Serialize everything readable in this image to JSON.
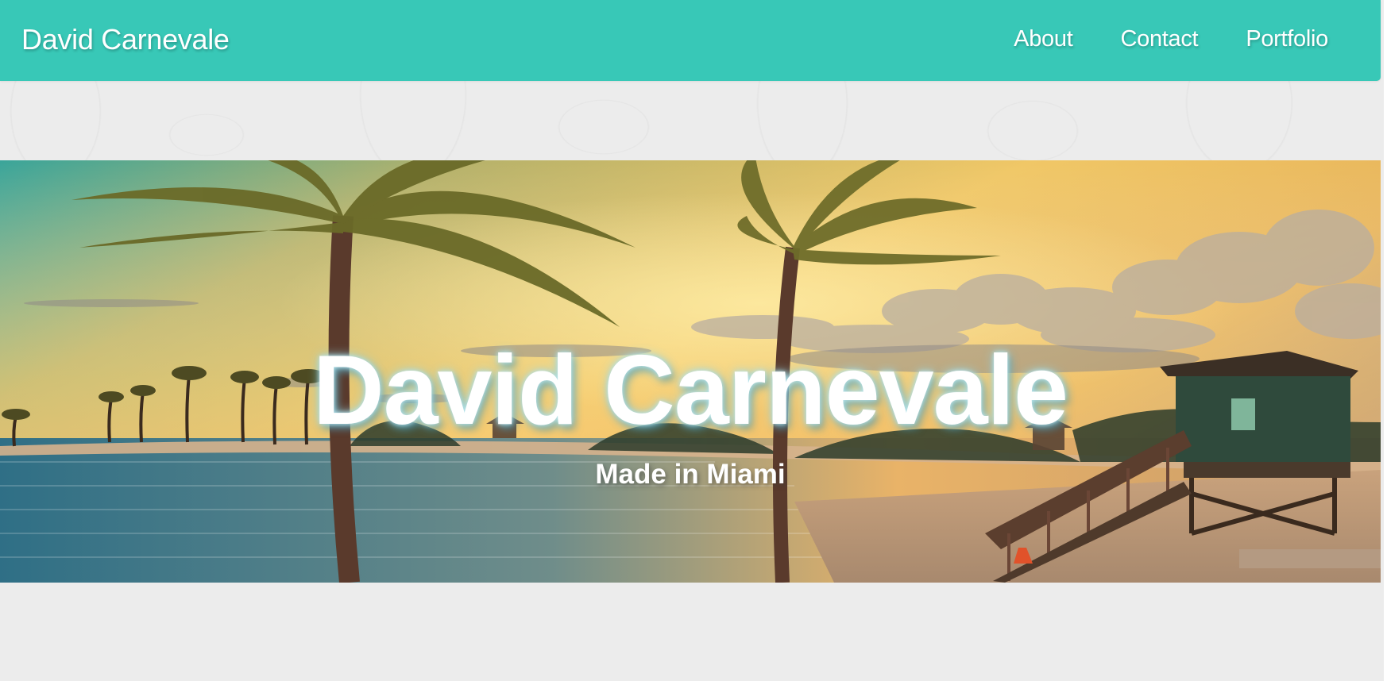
{
  "navbar": {
    "brand": "David Carnevale",
    "links": [
      {
        "label": "About"
      },
      {
        "label": "Contact"
      },
      {
        "label": "Portfolio"
      }
    ],
    "color": "#38c8b7"
  },
  "hero": {
    "title": "David Carnevale",
    "subtitle": "Made in Miami"
  },
  "colors": {
    "page_background": "#ececec",
    "text": "#ffffff"
  }
}
